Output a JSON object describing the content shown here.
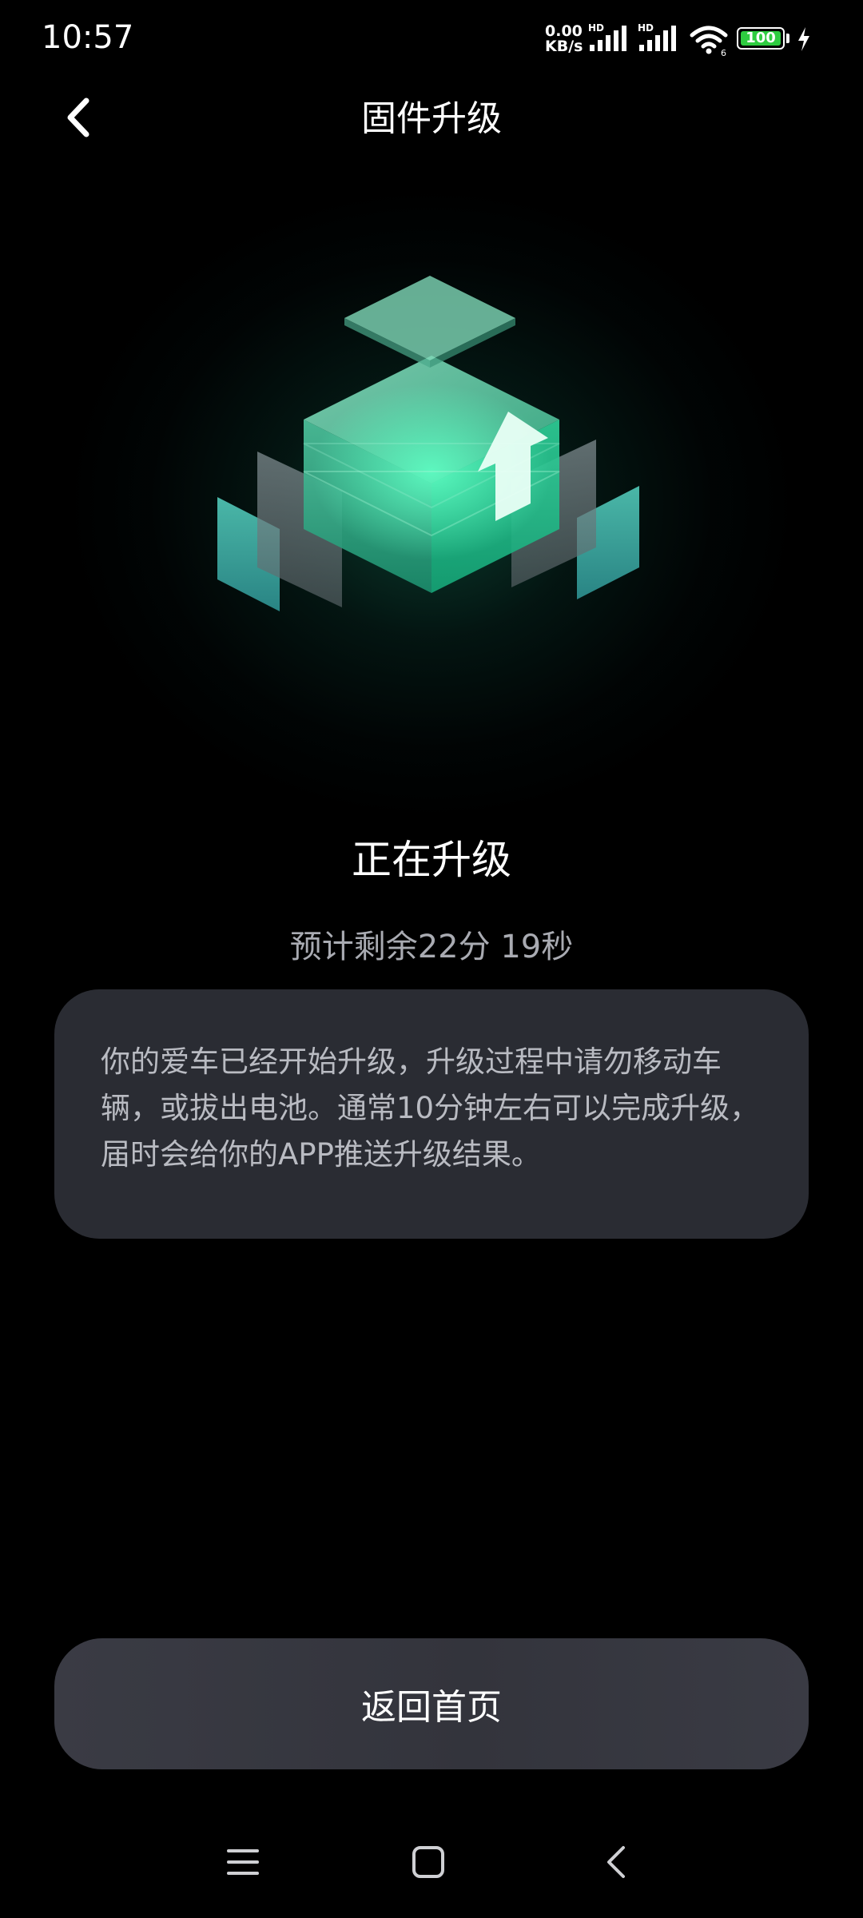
{
  "status_bar": {
    "time": "10:57",
    "net_speed_value": "0.00",
    "net_speed_unit": "KB/s",
    "signal1_label": "HD",
    "signal2_label": "HD",
    "battery": "100",
    "colors": {
      "battery_fill": "#2ecc40"
    },
    "icons": [
      "signal-icon",
      "wifi-icon",
      "battery-icon",
      "charging-icon"
    ]
  },
  "header": {
    "title": "固件升级",
    "back_icon": "chevron-left-icon"
  },
  "upgrade": {
    "status": "正在升级",
    "eta": "预计剩余22分 19秒",
    "info": "你的爱车已经开始升级，升级过程中请勿移动车辆，或拔出电池。通常10分钟左右可以完成升级，届时会给你的APP推送升级结果。",
    "accent_color": "#2fe0a0"
  },
  "actions": {
    "home_button": "返回首页"
  },
  "nav": {
    "icons": [
      "menu-icon",
      "home-square-icon",
      "back-triangle-icon"
    ]
  }
}
